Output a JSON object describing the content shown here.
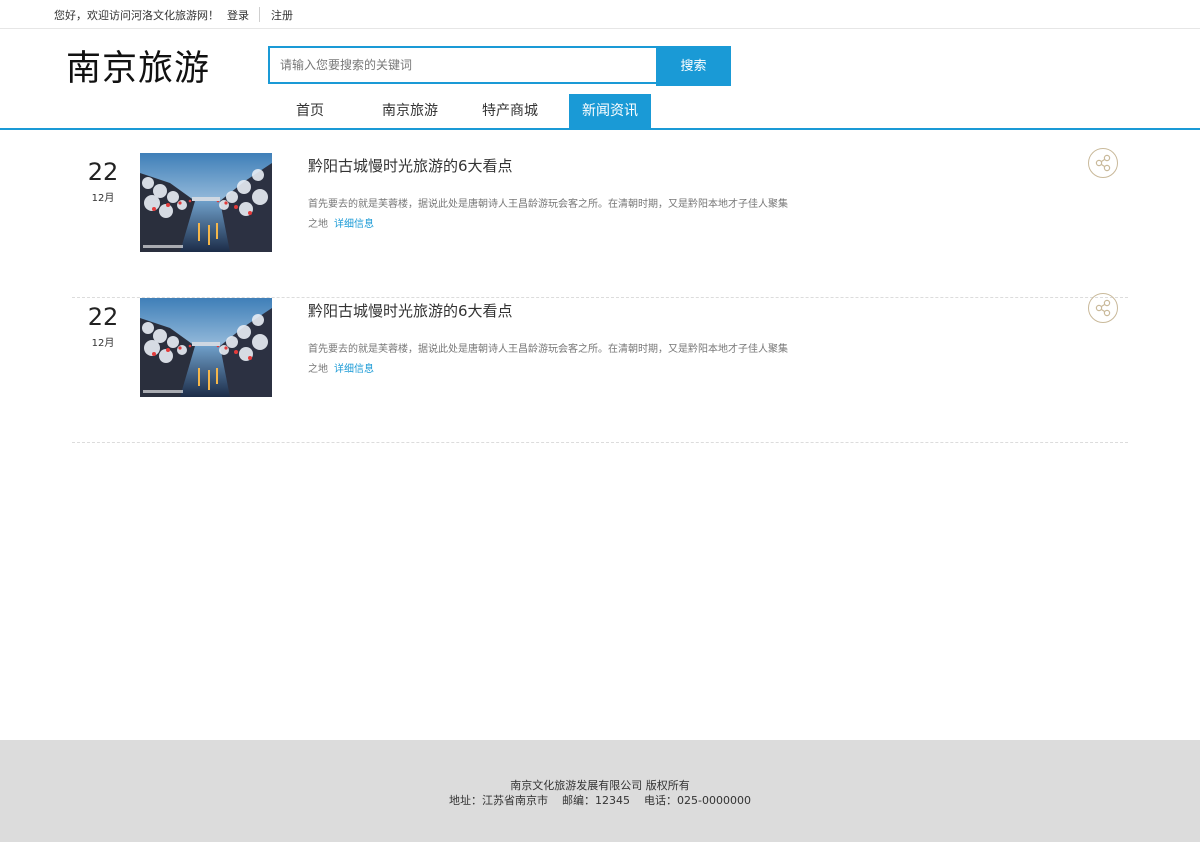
{
  "topbar": {
    "welcome": "您好，欢迎访问河洛文化旅游网！",
    "login": "登录",
    "register": "注册"
  },
  "header": {
    "logo": "南京旅游",
    "search_placeholder": "请输入您要搜索的关键词",
    "search_button": "搜索"
  },
  "nav": {
    "items": [
      {
        "label": "首页"
      },
      {
        "label": "南京旅游"
      },
      {
        "label": "特产商城"
      },
      {
        "label": "新闻资讯",
        "active": true
      }
    ]
  },
  "news": [
    {
      "day": "22",
      "month": "12月",
      "title": "黔阳古城慢时光旅游的6大看点",
      "summary": "首先要去的就是芙蓉楼，据说此处是唐朝诗人王昌龄游玩会客之所。在清朝时期，又是黔阳本地才子佳人聚集之地",
      "more": "详细信息"
    },
    {
      "day": "22",
      "month": "12月",
      "title": "黔阳古城慢时光旅游的6大看点",
      "summary": "首先要去的就是芙蓉楼，据说此处是唐朝诗人王昌龄游玩会客之所。在清朝时期，又是黔阳本地才子佳人聚集之地",
      "more": "详细信息"
    }
  ],
  "footer": {
    "copyright": "南京文化旅游发展有限公司 版权所有",
    "address": "地址：江苏省南京市    邮编：12345    电话：025-0000000"
  },
  "colors": {
    "accent": "#1a9ad6",
    "footer_bg": "#dcdcdc",
    "share_border": "#c9b99a"
  },
  "icons": {
    "share": "share-icon",
    "thumbnail": "canal-snow-scene-image"
  }
}
